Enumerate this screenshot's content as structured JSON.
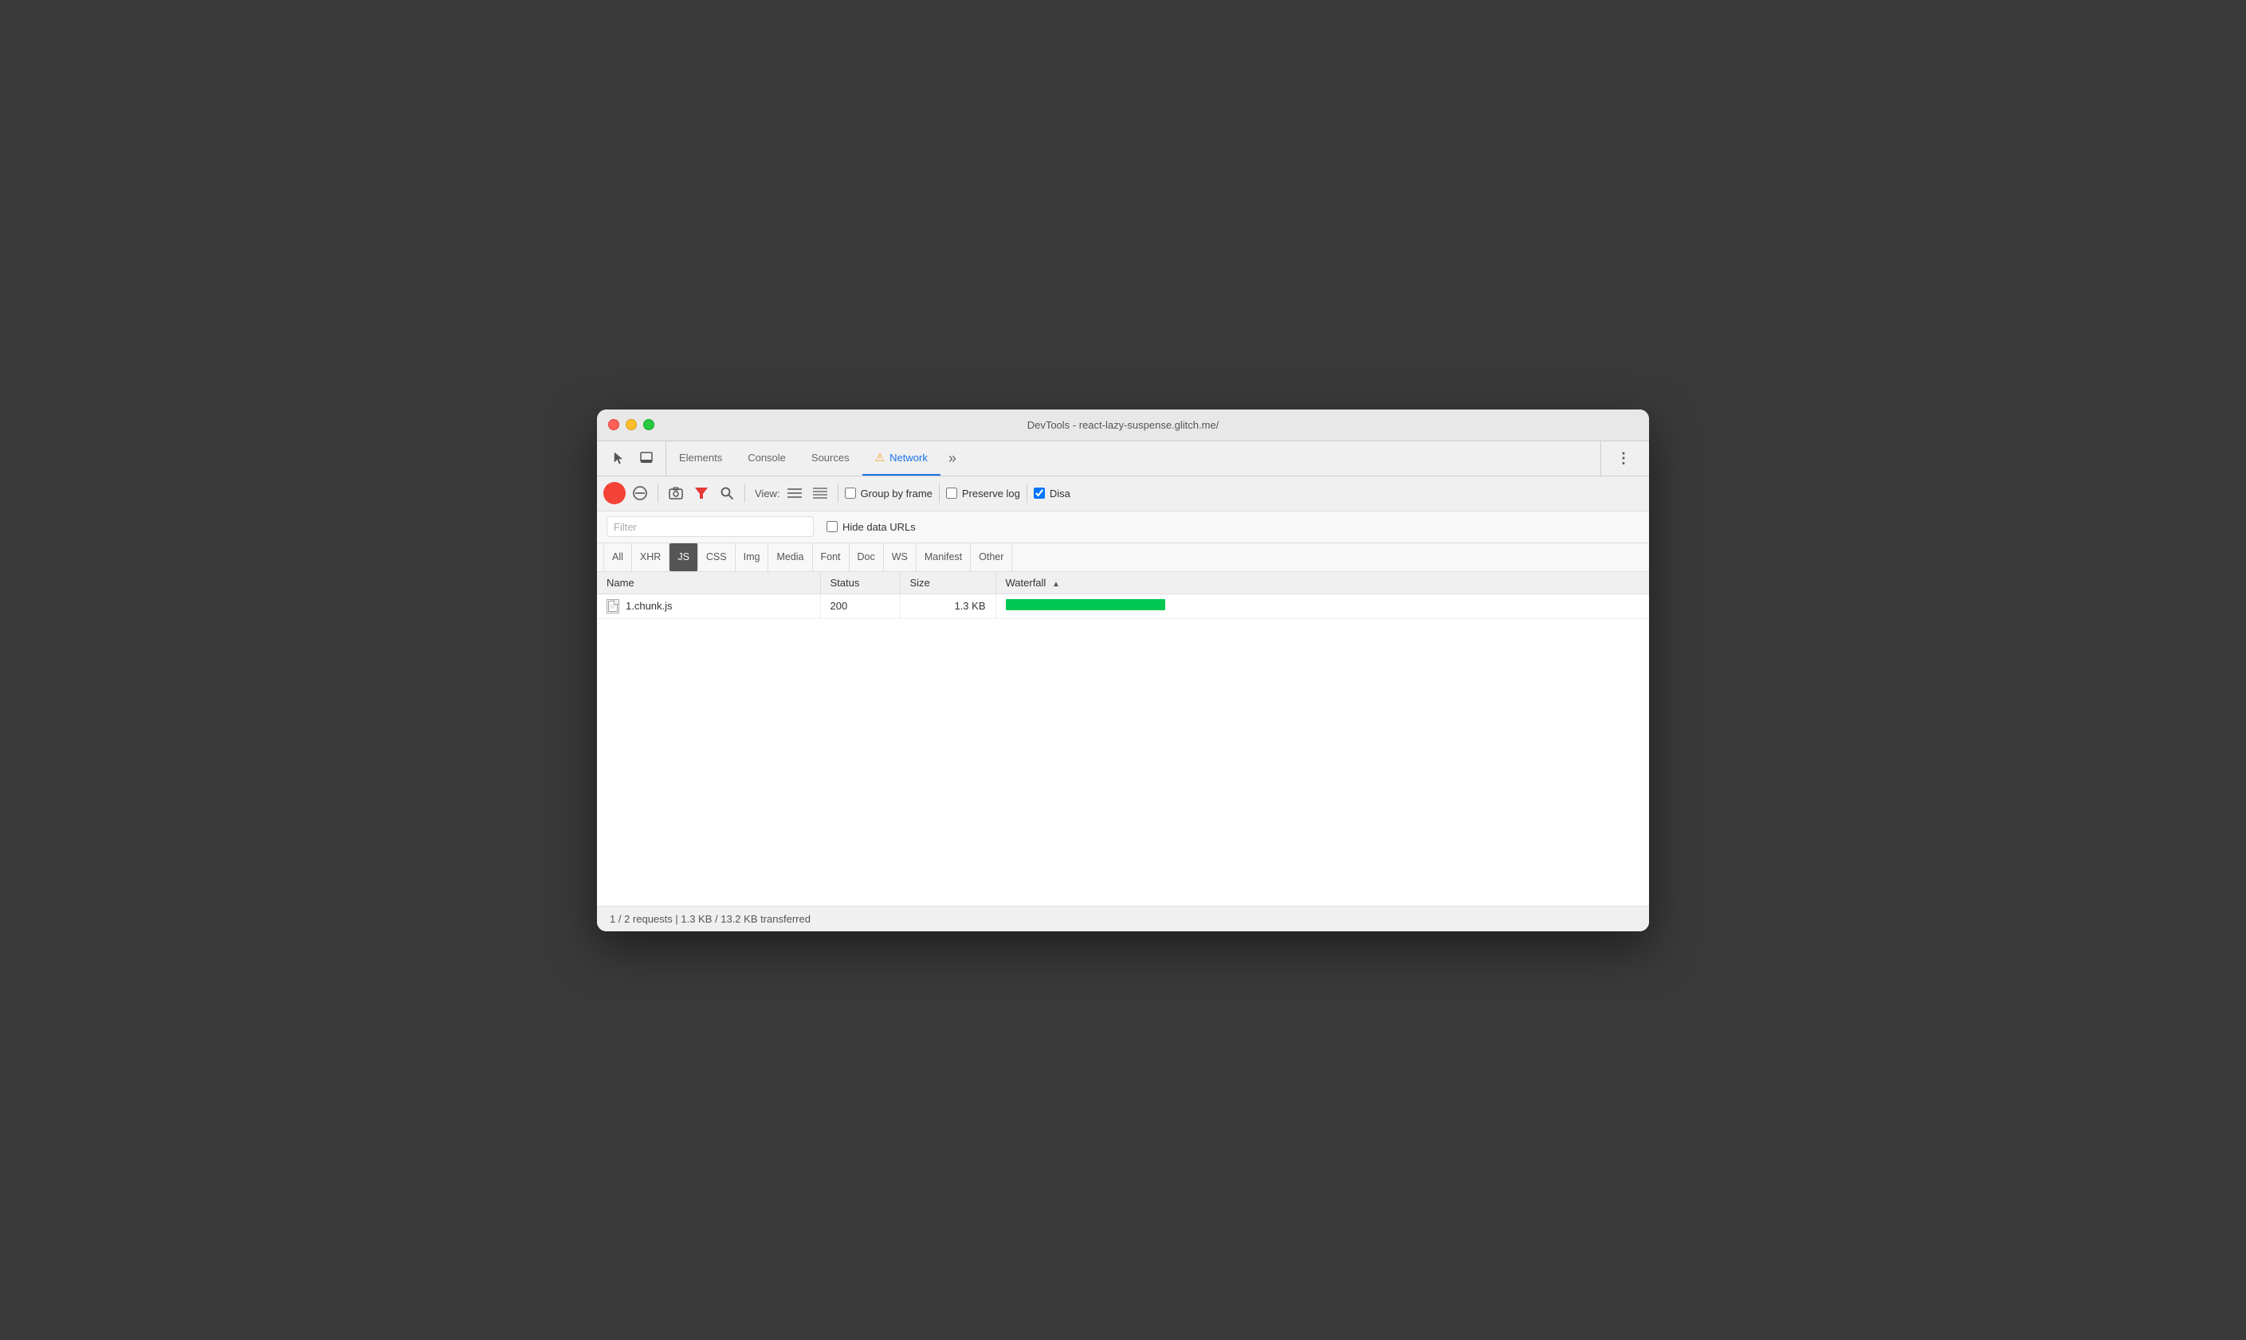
{
  "window": {
    "title": "DevTools - react-lazy-suspense.glitch.me/"
  },
  "tabs": {
    "items": [
      {
        "id": "elements",
        "label": "Elements",
        "active": false
      },
      {
        "id": "console",
        "label": "Console",
        "active": false
      },
      {
        "id": "sources",
        "label": "Sources",
        "active": false
      },
      {
        "id": "network",
        "label": "Network",
        "active": true
      },
      {
        "id": "more",
        "label": "»",
        "active": false
      }
    ]
  },
  "toolbar": {
    "record_title": "Stop recording network log",
    "clear_title": "Clear",
    "filter_title": "Filter",
    "search_title": "Search",
    "view_label": "View:",
    "group_by_frame_label": "Group by frame",
    "preserve_log_label": "Preserve log",
    "disable_cache_label": "Disa",
    "group_by_frame_checked": false,
    "preserve_log_checked": false,
    "disable_checked": true
  },
  "filter": {
    "placeholder": "Filter",
    "hide_data_urls_label": "Hide data URLs",
    "hide_data_urls_checked": false
  },
  "type_filters": [
    {
      "id": "all",
      "label": "All",
      "active": false
    },
    {
      "id": "xhr",
      "label": "XHR",
      "active": false
    },
    {
      "id": "js",
      "label": "JS",
      "active": true
    },
    {
      "id": "css",
      "label": "CSS",
      "active": false
    },
    {
      "id": "img",
      "label": "Img",
      "active": false
    },
    {
      "id": "media",
      "label": "Media",
      "active": false
    },
    {
      "id": "font",
      "label": "Font",
      "active": false
    },
    {
      "id": "doc",
      "label": "Doc",
      "active": false
    },
    {
      "id": "ws",
      "label": "WS",
      "active": false
    },
    {
      "id": "manifest",
      "label": "Manifest",
      "active": false
    },
    {
      "id": "other",
      "label": "Other",
      "active": false
    }
  ],
  "table": {
    "headers": [
      {
        "id": "name",
        "label": "Name"
      },
      {
        "id": "status",
        "label": "Status"
      },
      {
        "id": "size",
        "label": "Size"
      },
      {
        "id": "waterfall",
        "label": "Waterfall"
      }
    ],
    "rows": [
      {
        "name": "1.chunk.js",
        "status": "200",
        "size": "1.3 KB",
        "waterfall_width": 200
      }
    ]
  },
  "status_bar": {
    "text": "1 / 2 requests | 1.3 KB / 13.2 KB transferred"
  },
  "icons": {
    "cursor": "⬚",
    "dock": "⬜",
    "record_stop": "●",
    "no_entry": "🚫",
    "camera": "📷",
    "filter": "▼",
    "search": "🔍",
    "list_view": "≡",
    "tree_view": "≣",
    "more_vert": "⋮",
    "file": "📄",
    "warn": "⚠"
  }
}
